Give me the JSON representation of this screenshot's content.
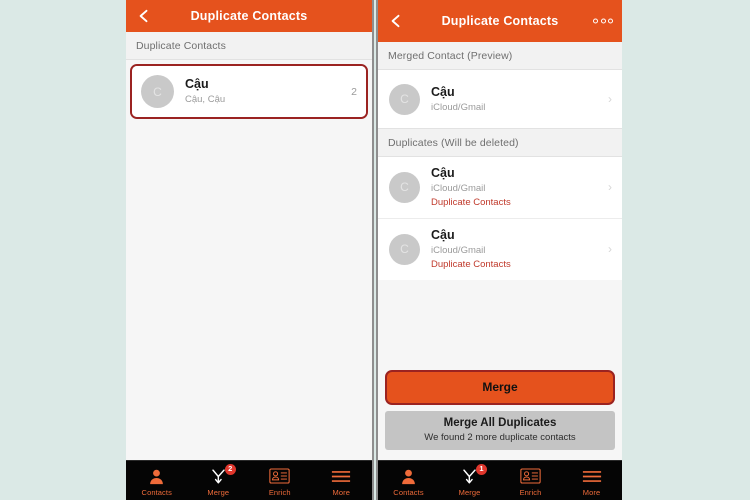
{
  "theme": {
    "accent_orange": "#e5521d",
    "accent_dark_red": "#9b2321",
    "badge_red": "#e0362c",
    "page_background": "#dbe9e6",
    "tabbar_background": "#050505",
    "tab_label_color": "#ef6b3a",
    "duplicate_tag_color": "#c0392b"
  },
  "left_screen": {
    "navbar": {
      "title": "Duplicate Contacts",
      "back_icon": "back-chevron-icon"
    },
    "section_header": "Duplicate Contacts",
    "contacts": [
      {
        "avatar_letter": "C",
        "name": "Cậu",
        "subtitle": "Cậu, Cậu",
        "count": "2",
        "highlighted": true
      }
    ],
    "tabbar": [
      {
        "label": "Contacts",
        "icon": "person-icon",
        "badge": "",
        "active": true
      },
      {
        "label": "Merge",
        "icon": "merge-arrows-icon",
        "badge": "2",
        "active": false
      },
      {
        "label": "Enrich",
        "icon": "contact-card-icon",
        "badge": "",
        "active": false
      },
      {
        "label": "More",
        "icon": "hamburger-icon",
        "badge": "",
        "active": false
      }
    ]
  },
  "right_screen": {
    "navbar": {
      "title": "Duplicate Contacts",
      "back_icon": "back-chevron-icon",
      "more_icon": "more-options-icon"
    },
    "merged_section": {
      "header": "Merged Contact (Preview)",
      "contact": {
        "avatar_letter": "C",
        "name": "Cậu",
        "subtitle": "iCloud/Gmail",
        "chevron": "›"
      }
    },
    "duplicates_section": {
      "header": "Duplicates (Will be deleted)",
      "contacts": [
        {
          "avatar_letter": "C",
          "name": "Cậu",
          "subtitle": "iCloud/Gmail",
          "tag": "Duplicate Contacts",
          "chevron": "›"
        },
        {
          "avatar_letter": "C",
          "name": "Cậu",
          "subtitle": "iCloud/Gmail",
          "tag": "Duplicate Contacts",
          "chevron": "›"
        }
      ]
    },
    "actions": {
      "merge_label": "Merge",
      "merge_all_label": "Merge All Duplicates",
      "merge_all_sublabel": "We found 2 more duplicate contacts"
    },
    "tabbar": [
      {
        "label": "Contacts",
        "icon": "person-icon",
        "badge": "",
        "active": true
      },
      {
        "label": "Merge",
        "icon": "merge-arrows-icon",
        "badge": "1",
        "active": false
      },
      {
        "label": "Enrich",
        "icon": "contact-card-icon",
        "badge": "",
        "active": false
      },
      {
        "label": "More",
        "icon": "hamburger-icon",
        "badge": "",
        "active": false
      }
    ]
  }
}
